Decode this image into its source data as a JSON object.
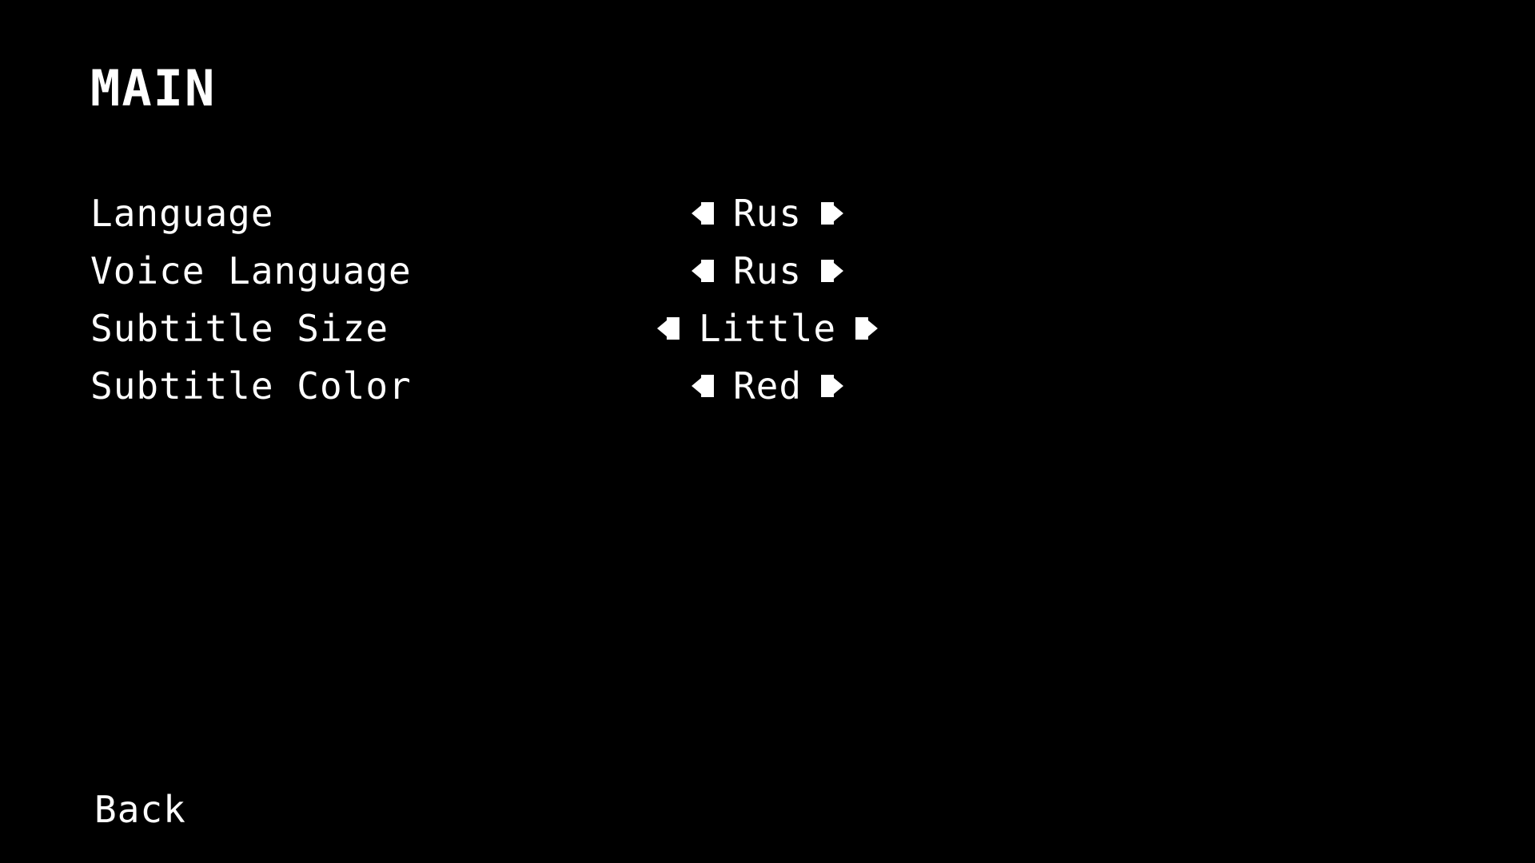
{
  "menu": {
    "title": "MAIN",
    "back_label": "Back"
  },
  "settings": [
    {
      "label": "Language",
      "value": "Rus"
    },
    {
      "label": "Voice Language",
      "value": "Rus"
    },
    {
      "label": "Subtitle Size",
      "value": "Little"
    },
    {
      "label": "Subtitle Color",
      "value": "Red"
    }
  ],
  "icons": {
    "prev": "arrow-left-icon",
    "next": "arrow-right-icon"
  },
  "colors": {
    "background": "#000000",
    "text": "#ffffff"
  }
}
